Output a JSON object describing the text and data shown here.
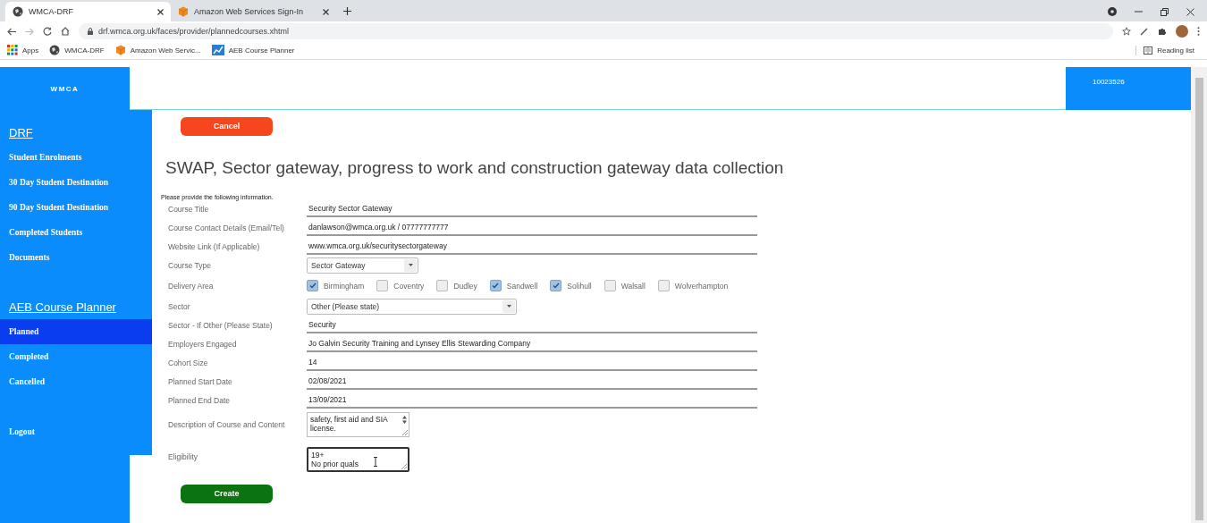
{
  "browser": {
    "tabs": [
      {
        "title": "WMCA-DRF",
        "kind": "globe",
        "selected": true
      },
      {
        "title": "Amazon Web Services Sign-In",
        "kind": "aws",
        "selected": false
      }
    ],
    "url": "drf.wmca.org.uk/faces/provider/plannedcourses.xhtml",
    "bookmarks": [
      {
        "label": "Apps",
        "kind": "apps"
      },
      {
        "label": "WMCA-DRF",
        "kind": "globe"
      },
      {
        "label": "Amazon Web Servic...",
        "kind": "aws"
      },
      {
        "label": "AEB Course Planner",
        "kind": "chart"
      }
    ],
    "reading_list": "Reading list"
  },
  "header": {
    "logo": "WMCA",
    "provider_id": "10023526"
  },
  "sidebar": {
    "sections": [
      {
        "title": "DRF",
        "items": [
          {
            "label": "Student Enrolments",
            "selected": false
          },
          {
            "label": "30 Day Student Destination",
            "selected": false
          },
          {
            "label": "90 Day Student Destination",
            "selected": false
          },
          {
            "label": "Completed Students",
            "selected": false
          },
          {
            "label": "Documents",
            "selected": false
          }
        ]
      },
      {
        "title": "AEB Course Planner",
        "items": [
          {
            "label": "Planned",
            "selected": true
          },
          {
            "label": "Completed",
            "selected": false
          },
          {
            "label": "Cancelled",
            "selected": false
          }
        ]
      }
    ],
    "logout": "Logout"
  },
  "form": {
    "cancel": "Cancel",
    "title": "SWAP, Sector gateway, progress to work and construction gateway data collection",
    "intro": "Please provide the following information.",
    "fields": [
      {
        "kind": "text",
        "label": "Course Title",
        "value": "Security Sector Gateway"
      },
      {
        "kind": "text",
        "label": "Course Contact Details (Email/Tel)",
        "value": "danlawson@wmca.org.uk / 07777777777"
      },
      {
        "kind": "text",
        "label": "Website Link (If Applicable)",
        "value": "www.wmca.org.uk/securitysectorgateway"
      },
      {
        "kind": "select",
        "label": "Course Type",
        "value": "Sector Gateway"
      },
      {
        "kind": "checkboxes",
        "label": "Delivery Area",
        "options": [
          {
            "label": "Birmingham",
            "checked": true
          },
          {
            "label": "Coventry",
            "checked": false
          },
          {
            "label": "Dudley",
            "checked": false
          },
          {
            "label": "Sandwell",
            "checked": true
          },
          {
            "label": "Solihull",
            "checked": true
          },
          {
            "label": "Walsall",
            "checked": false
          },
          {
            "label": "Wolverhampton",
            "checked": false
          }
        ]
      },
      {
        "kind": "select",
        "label": "Sector",
        "value": "Other (Please state)"
      },
      {
        "kind": "text",
        "label": "Sector - If Other (Please State)",
        "value": "Security"
      },
      {
        "kind": "text",
        "label": "Employers Engaged",
        "value": "Jo Galvin Security Training and Lynsey Ellis Stewarding Company"
      },
      {
        "kind": "text",
        "label": "Cohort Size",
        "value": "14"
      },
      {
        "kind": "text",
        "label": "Planned Start Date",
        "value": "02/08/2021"
      },
      {
        "kind": "text",
        "label": "Planned End Date",
        "value": "13/09/2021"
      },
      {
        "kind": "textarea",
        "label": "Description of Course and Content",
        "value": "safety, first aid and SIA\nlicense.",
        "focused": false
      },
      {
        "kind": "textarea",
        "label": "Eligibility",
        "value": "19+\nNo prior quals",
        "focused": true
      }
    ],
    "create": "Create"
  }
}
